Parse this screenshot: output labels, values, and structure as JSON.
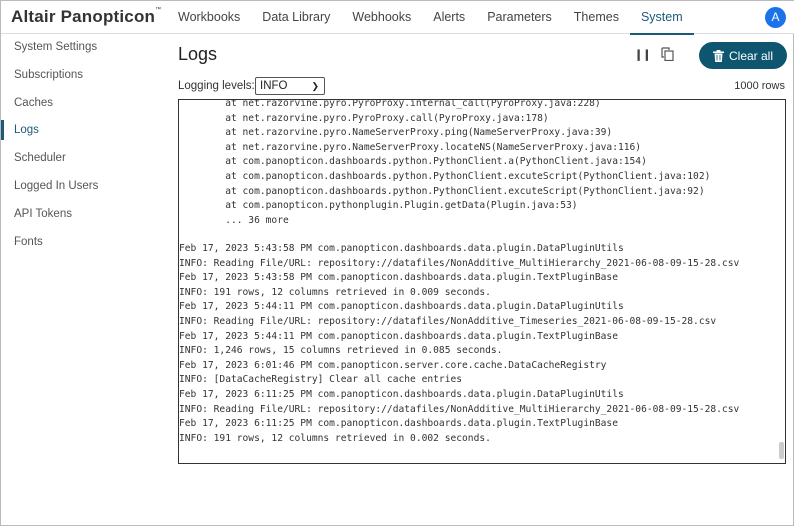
{
  "app": {
    "logo": "Altair Panopticon",
    "logo_mark": "™",
    "avatar": "A"
  },
  "tabs": [
    {
      "label": "Workbooks"
    },
    {
      "label": "Data Library"
    },
    {
      "label": "Webhooks"
    },
    {
      "label": "Alerts"
    },
    {
      "label": "Parameters"
    },
    {
      "label": "Themes"
    },
    {
      "label": "System",
      "active": true
    }
  ],
  "sidebar": [
    {
      "label": "System Settings"
    },
    {
      "label": "Subscriptions"
    },
    {
      "label": "Caches"
    },
    {
      "label": "Logs",
      "active": true
    },
    {
      "label": "Scheduler"
    },
    {
      "label": "Logged In Users"
    },
    {
      "label": "API Tokens"
    },
    {
      "label": "Fonts"
    }
  ],
  "main": {
    "title": "Logs",
    "pause_icon": "pause-icon",
    "copy_icon": "copy-icon",
    "clear_label": "Clear all",
    "logging_label": "Logging levels:",
    "logging_value": "INFO",
    "rows": "1000 rows"
  },
  "colors": {
    "accent": "#0e5570",
    "avatar": "#1a73e8"
  },
  "log_stack": [
    "        at net.razorvine.pyro.PyroProxy.internal_call(PyroProxy.java:228)",
    "        at net.razorvine.pyro.PyroProxy.call(PyroProxy.java:178)",
    "        at net.razorvine.pyro.NameServerProxy.ping(NameServerProxy.java:39)",
    "        at net.razorvine.pyro.NameServerProxy.locateNS(NameServerProxy.java:116)",
    "        at com.panopticon.dashboards.python.PythonClient.a(PythonClient.java:154)",
    "        at com.panopticon.dashboards.python.PythonClient.excuteScript(PythonClient.java:102)",
    "        at com.panopticon.dashboards.python.PythonClient.excuteScript(PythonClient.java:92)",
    "        at com.panopticon.pythonplugin.Plugin.getData(Plugin.java:53)",
    "        ... 36 more"
  ],
  "log_entries": [
    "Feb 17, 2023 5:43:58 PM com.panopticon.dashboards.data.plugin.DataPluginUtils",
    "INFO: Reading File/URL: repository://datafiles/NonAdditive_MultiHierarchy_2021-06-08-09-15-28.csv",
    "Feb 17, 2023 5:43:58 PM com.panopticon.dashboards.data.plugin.TextPluginBase",
    "INFO: 191 rows, 12 columns retrieved in 0.009 seconds.",
    "Feb 17, 2023 5:44:11 PM com.panopticon.dashboards.data.plugin.DataPluginUtils",
    "INFO: Reading File/URL: repository://datafiles/NonAdditive_Timeseries_2021-06-08-09-15-28.csv",
    "Feb 17, 2023 5:44:11 PM com.panopticon.dashboards.data.plugin.TextPluginBase",
    "INFO: 1,246 rows, 15 columns retrieved in 0.085 seconds.",
    "Feb 17, 2023 6:01:46 PM com.panopticon.server.core.cache.DataCacheRegistry",
    "INFO: [DataCacheRegistry] Clear all cache entries",
    "Feb 17, 2023 6:11:25 PM com.panopticon.dashboards.data.plugin.DataPluginUtils",
    "INFO: Reading File/URL: repository://datafiles/NonAdditive_MultiHierarchy_2021-06-08-09-15-28.csv",
    "Feb 17, 2023 6:11:25 PM com.panopticon.dashboards.data.plugin.TextPluginBase",
    "INFO: 191 rows, 12 columns retrieved in 0.002 seconds."
  ]
}
